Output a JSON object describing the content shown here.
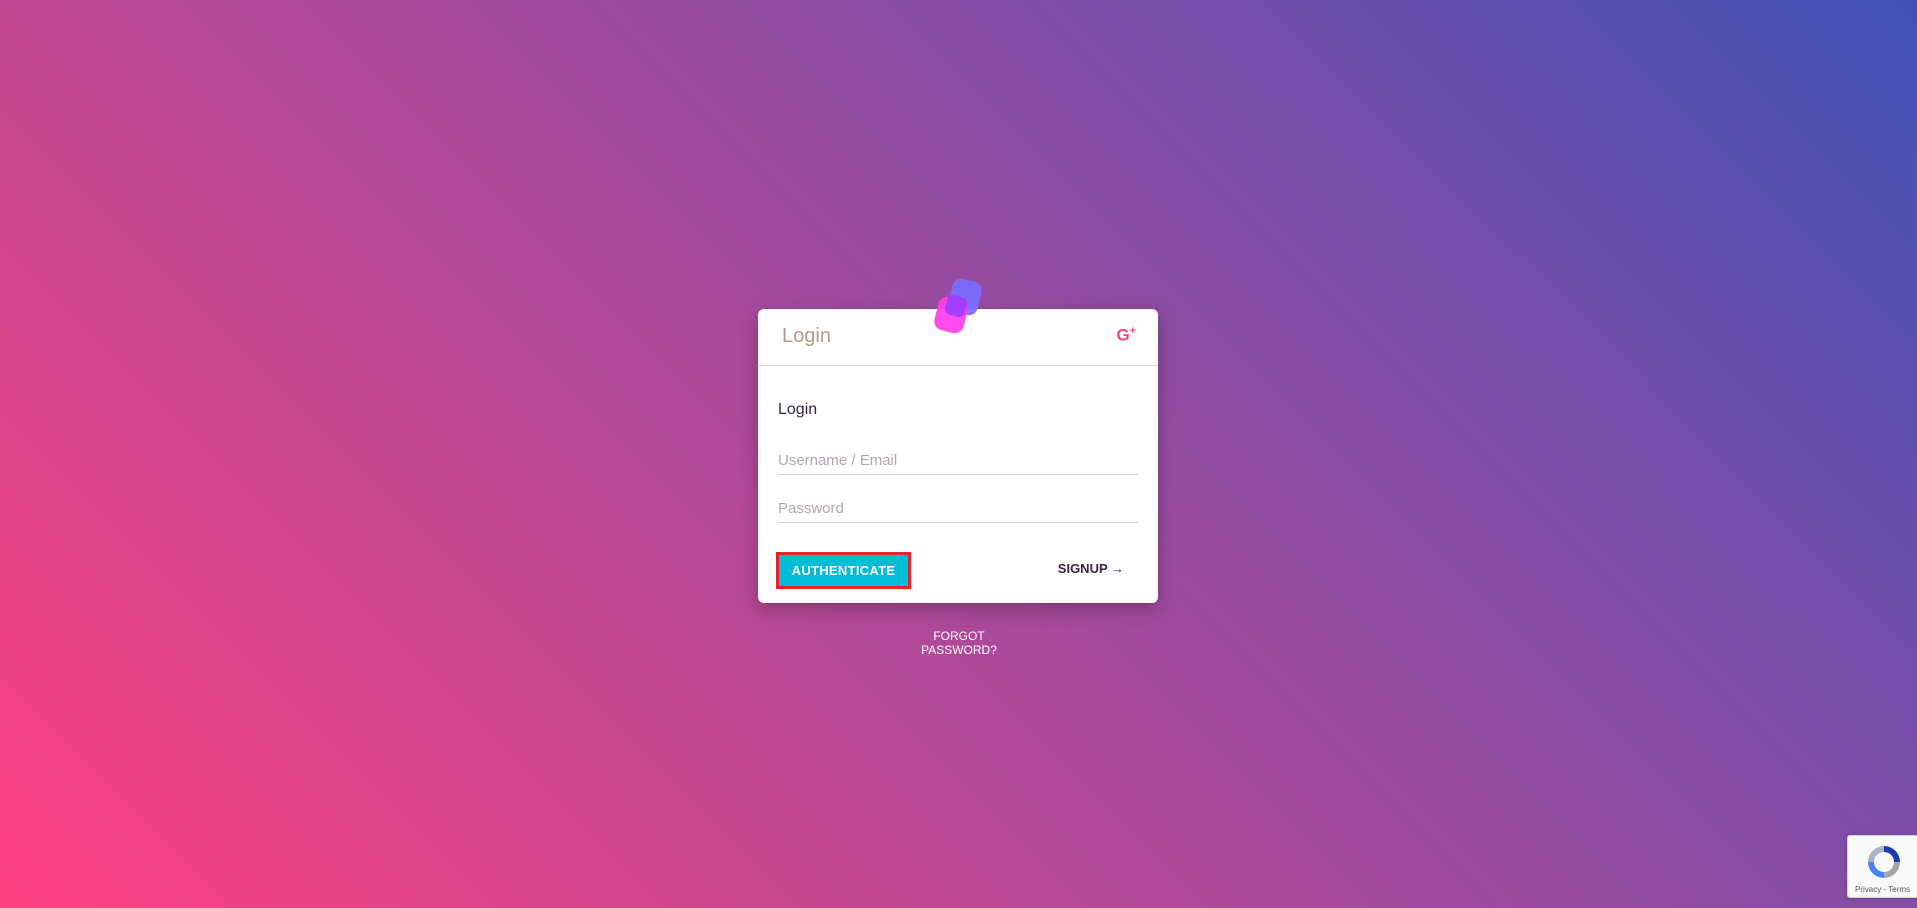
{
  "card": {
    "title": "Login",
    "social_icon": "google-plus-icon",
    "social_label": "G",
    "social_plus": "+"
  },
  "form": {
    "section_label": "Login",
    "username_placeholder": "Username / Email",
    "password_placeholder": "Password",
    "authenticate_label": "AUTHENTICATE",
    "signup_label": "SIGNUP →"
  },
  "links": {
    "forgot_password": "FORGOT PASSWORD?"
  },
  "recaptcha": {
    "icon": "recaptcha-icon",
    "text": "Privacy - Terms"
  },
  "colors": {
    "accent": "#00bcd4",
    "highlight_border": "#e8212b",
    "gplus": "#e8467a"
  }
}
